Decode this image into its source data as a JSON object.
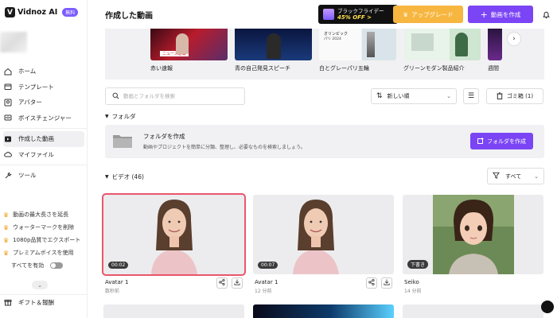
{
  "app": {
    "logo_text": "Vidnoz AI",
    "logo_badge": "無料"
  },
  "sidebar": {
    "items": [
      {
        "label": "ホーム",
        "icon": "home-icon"
      },
      {
        "label": "テンプレート",
        "icon": "template-icon"
      },
      {
        "label": "アバター",
        "icon": "avatar-icon"
      },
      {
        "label": "ボイスチェンジャー",
        "icon": "voice-changer-icon"
      },
      {
        "label": "作成した動画",
        "icon": "video-icon",
        "active": true
      },
      {
        "label": "マイファイル",
        "icon": "cloud-icon"
      },
      {
        "label": "ツール",
        "icon": "tools-icon"
      }
    ],
    "promos": [
      "動画の最大長さを延長",
      "ウォーターマークを削除",
      "1080p品質でエクスポート",
      "プレミアムボイスを使用"
    ],
    "enable_all_label": "すべてを有効",
    "gift_label": "ギフト＆報酬"
  },
  "header": {
    "title": "作成した動画",
    "bf_line1": "ブラックフライデー",
    "bf_line2": "45% OFF >",
    "upgrade_label": "アップグレード",
    "create_label": "動画を作成"
  },
  "templates": [
    {
      "name": "赤い速報"
    },
    {
      "name": "青の自己発見スピーチ"
    },
    {
      "name": "白とグレーパリ五輪",
      "overlay_line1": "オリンピック",
      "overlay_line2": "パリ 2024"
    },
    {
      "name": "グリーンモダン製品紹介"
    },
    {
      "name": "週間"
    }
  ],
  "template_overlay": {
    "news": "ニュース速報"
  },
  "toolbar": {
    "search_placeholder": "動画とフォルダを検索",
    "sort_label": "新しい順",
    "trash_label": "ゴミ箱 (1)"
  },
  "folders": {
    "section_label": "フォルダ",
    "create_title": "フォルダを作成",
    "create_desc": "動画やプロジェクトを簡単に分類、整理し、必要なものを検索しましょう。",
    "create_button": "フォルダを作成"
  },
  "videos": {
    "section_label": "ビデオ (46)",
    "filter_label": "すべて",
    "items": [
      {
        "title": "Avatar 1",
        "meta": "数秒前",
        "badge": "00:02",
        "selected": true
      },
      {
        "title": "Avatar 1",
        "meta": "12 分前",
        "badge": "00:07",
        "selected": false
      },
      {
        "title": "Seiko",
        "meta": "14 分前",
        "badge": "下書き",
        "selected": false
      }
    ]
  },
  "colors": {
    "accent": "#7b45f5",
    "upgrade": "#f7b640",
    "selection": "#e9566b"
  }
}
